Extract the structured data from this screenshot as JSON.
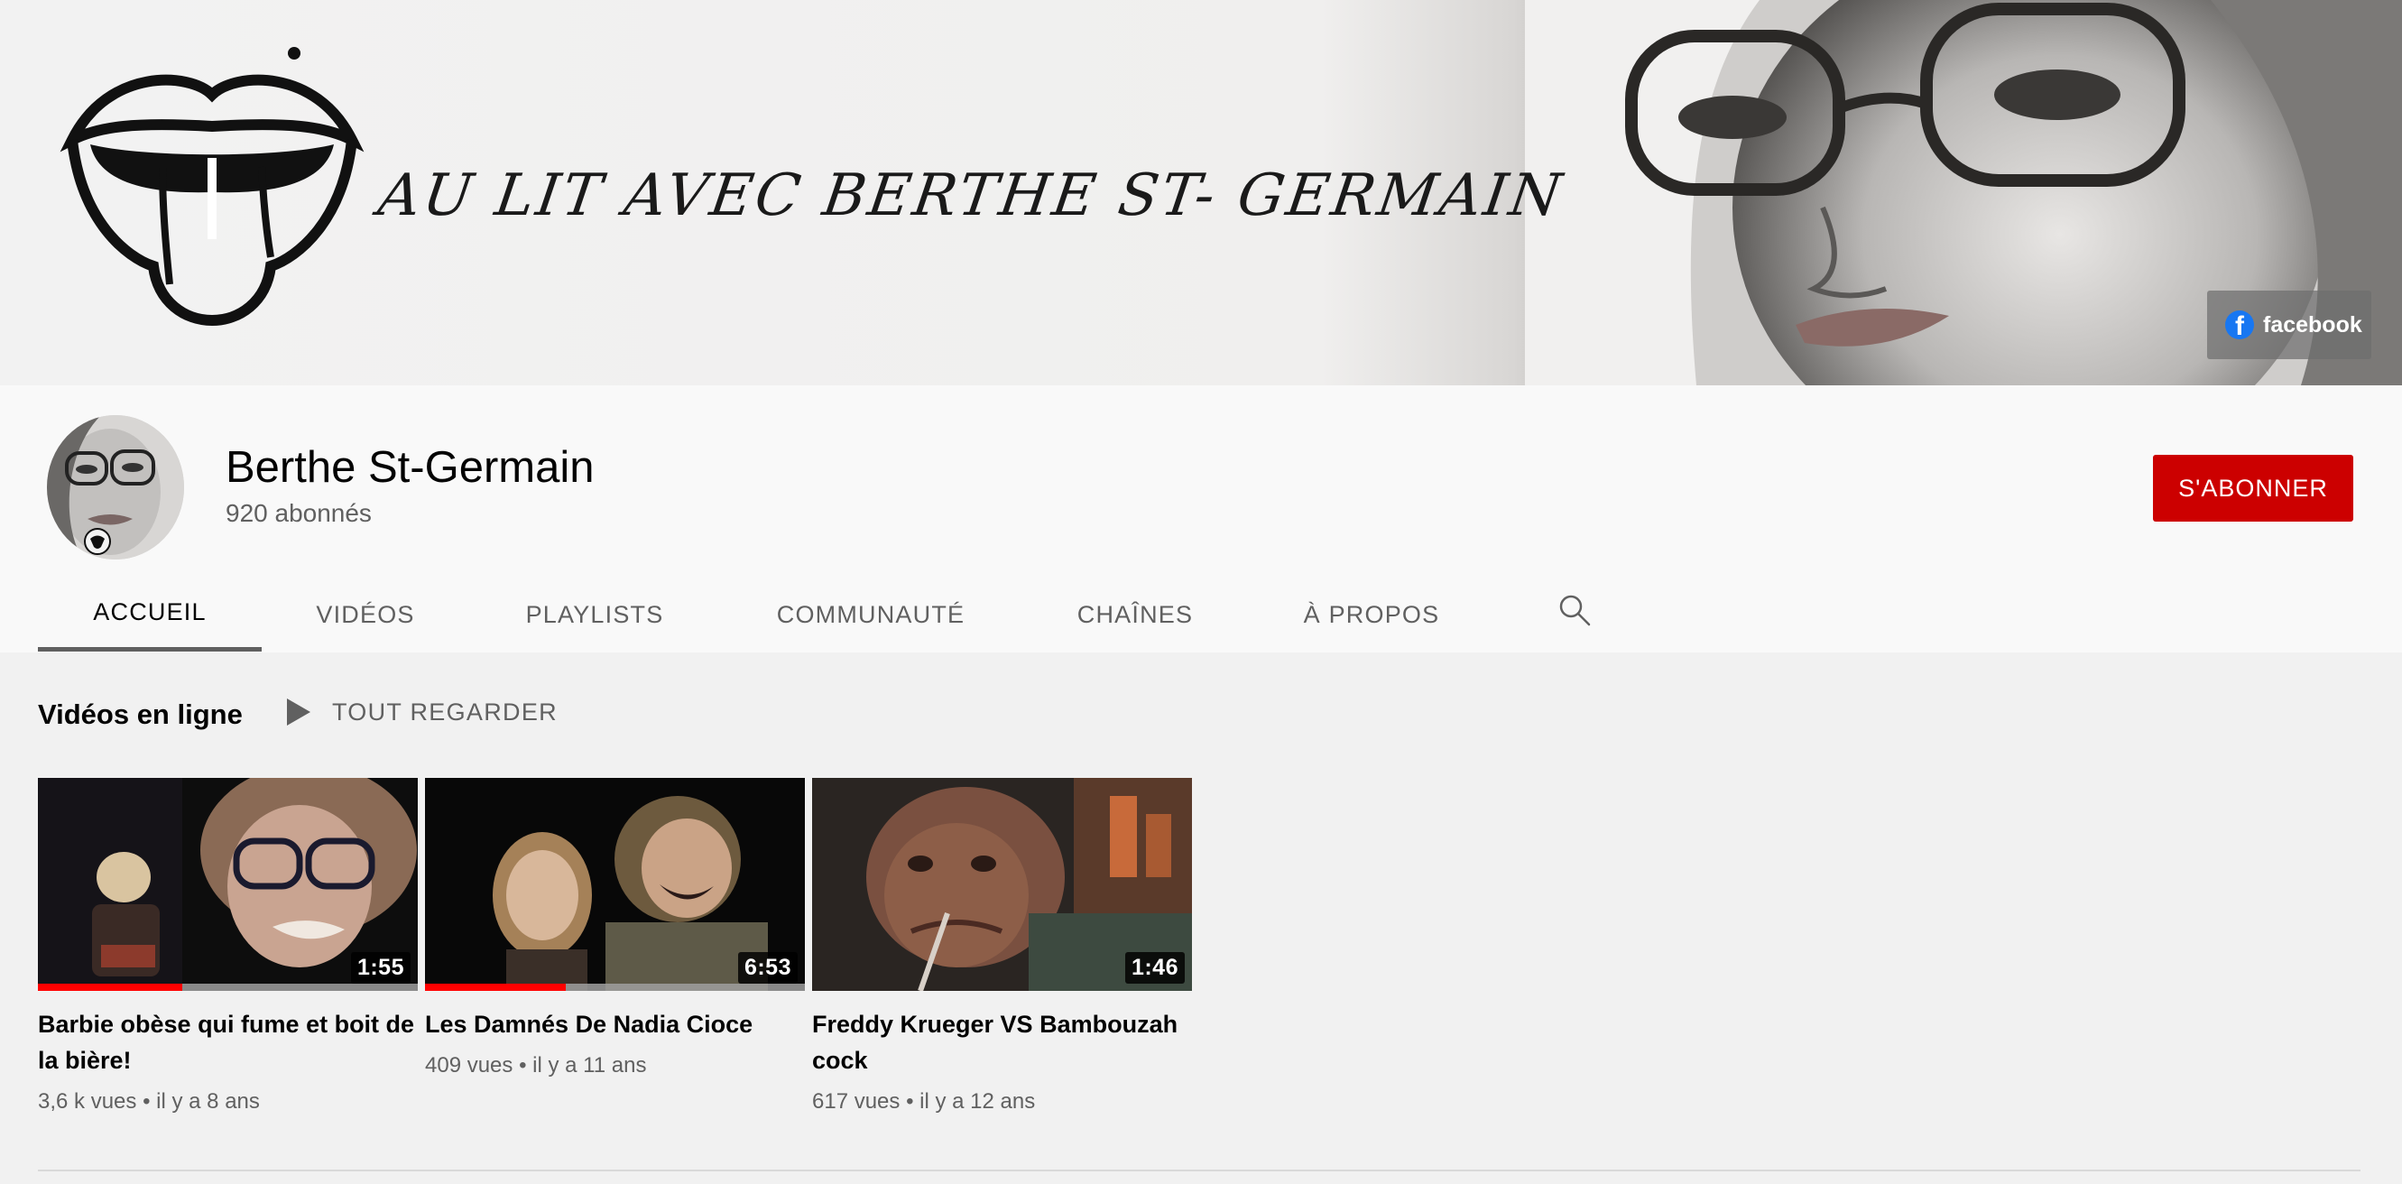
{
  "banner": {
    "title": "AU LIT AVEC BERTHE ST- GERMAIN",
    "facebook_link_label": "facebook",
    "facebook_color": "#1877f2"
  },
  "channel": {
    "name": "Berthe St-Germain",
    "subscribers": "920 abonnés",
    "subscribe_label": "S'ABONNER",
    "subscribe_color": "#cc0000"
  },
  "tabs": [
    {
      "label": "ACCUEIL",
      "active": true
    },
    {
      "label": "VIDÉOS",
      "active": false
    },
    {
      "label": "PLAYLISTS",
      "active": false
    },
    {
      "label": "COMMUNAUTÉ",
      "active": false
    },
    {
      "label": "CHAÎNES",
      "active": false
    },
    {
      "label": "À PROPOS",
      "active": false
    }
  ],
  "search_icon": "search-icon",
  "shelf": {
    "title": "Vidéos en ligne",
    "play_all_label": "TOUT REGARDER",
    "videos": [
      {
        "title": "Barbie obèse qui fume et boit de la bière!",
        "views": "3,6 k vues",
        "age": "il y a 8 ans",
        "duration": "1:55",
        "watched_fraction": 0.38
      },
      {
        "title": "Les Damnés De Nadia Cioce",
        "views": "409 vues",
        "age": "il y a 11 ans",
        "duration": "6:53",
        "watched_fraction": 0.37
      },
      {
        "title": "Freddy Krueger VS Bambouzah cock",
        "views": "617 vues",
        "age": "il y a 12 ans",
        "duration": "1:46",
        "watched_fraction": 0
      }
    ]
  },
  "separator": "•",
  "progress_color": "#ff0000"
}
